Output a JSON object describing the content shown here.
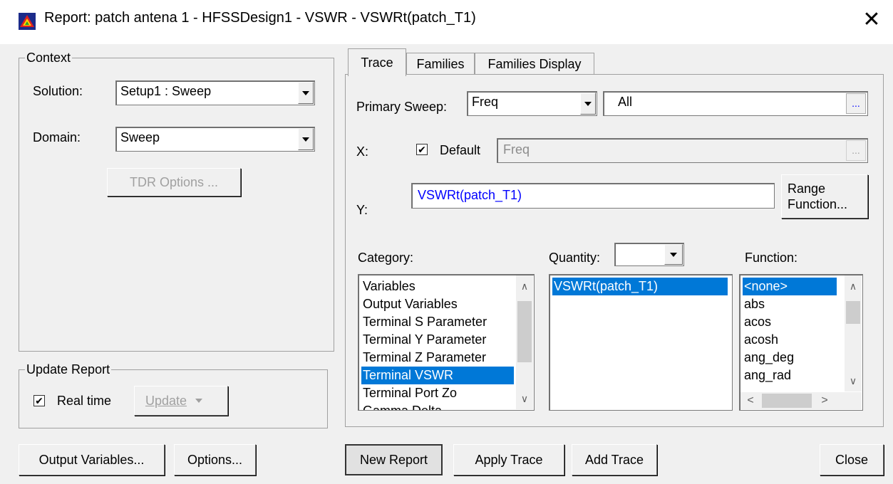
{
  "window": {
    "title": "Report: patch antena 1 - HFSSDesign1 - VSWR - VSWRt(patch_T1)",
    "close_glyph": "✕"
  },
  "context": {
    "legend": "Context",
    "solution_label": "Solution:",
    "solution_value": "Setup1 : Sweep",
    "domain_label": "Domain:",
    "domain_value": "Sweep",
    "tdr_button": "TDR Options ..."
  },
  "update_report": {
    "legend": "Update Report",
    "realtime_label": "Real time",
    "realtime_checked": true,
    "update_button": "Update"
  },
  "tabs": [
    "Trace",
    "Families",
    "Families Display"
  ],
  "trace": {
    "primary_sweep_label": "Primary Sweep:",
    "primary_sweep_value": "Freq",
    "sweep_range_value": "All",
    "ellipsis": "...",
    "x_label": "X:",
    "x_default_label": "Default",
    "x_default_checked": true,
    "x_value": "Freq",
    "y_label": "Y:",
    "y_value": "VSWRt(patch_T1)",
    "range_function_line1": "Range",
    "range_function_line2": "Function...",
    "category_label": "Category:",
    "quantity_label": "Quantity:",
    "quantity_filter_value": "",
    "function_label": "Function:",
    "categories": [
      "Variables",
      "Output Variables",
      "Terminal S Parameter",
      "Terminal Y Parameter",
      "Terminal Z Parameter",
      "Terminal VSWR",
      "Terminal Port Zo",
      "Gamma Delta"
    ],
    "selected_category": "Terminal VSWR",
    "quantities": [
      "VSWRt(patch_T1)"
    ],
    "selected_quantity": "VSWRt(patch_T1)",
    "functions": [
      "<none>",
      "abs",
      "acos",
      "acosh",
      "ang_deg",
      "ang_rad"
    ],
    "selected_function": "<none>"
  },
  "bottom_buttons": {
    "output_variables": "Output Variables...",
    "options": "Options...",
    "new_report": "New Report",
    "apply_trace": "Apply Trace",
    "add_trace": "Add Trace",
    "close": "Close"
  },
  "colors": {
    "selection": "#0078d7",
    "link_blue_text": "#0000ff",
    "dialog_bg": "#f0f0f0"
  }
}
